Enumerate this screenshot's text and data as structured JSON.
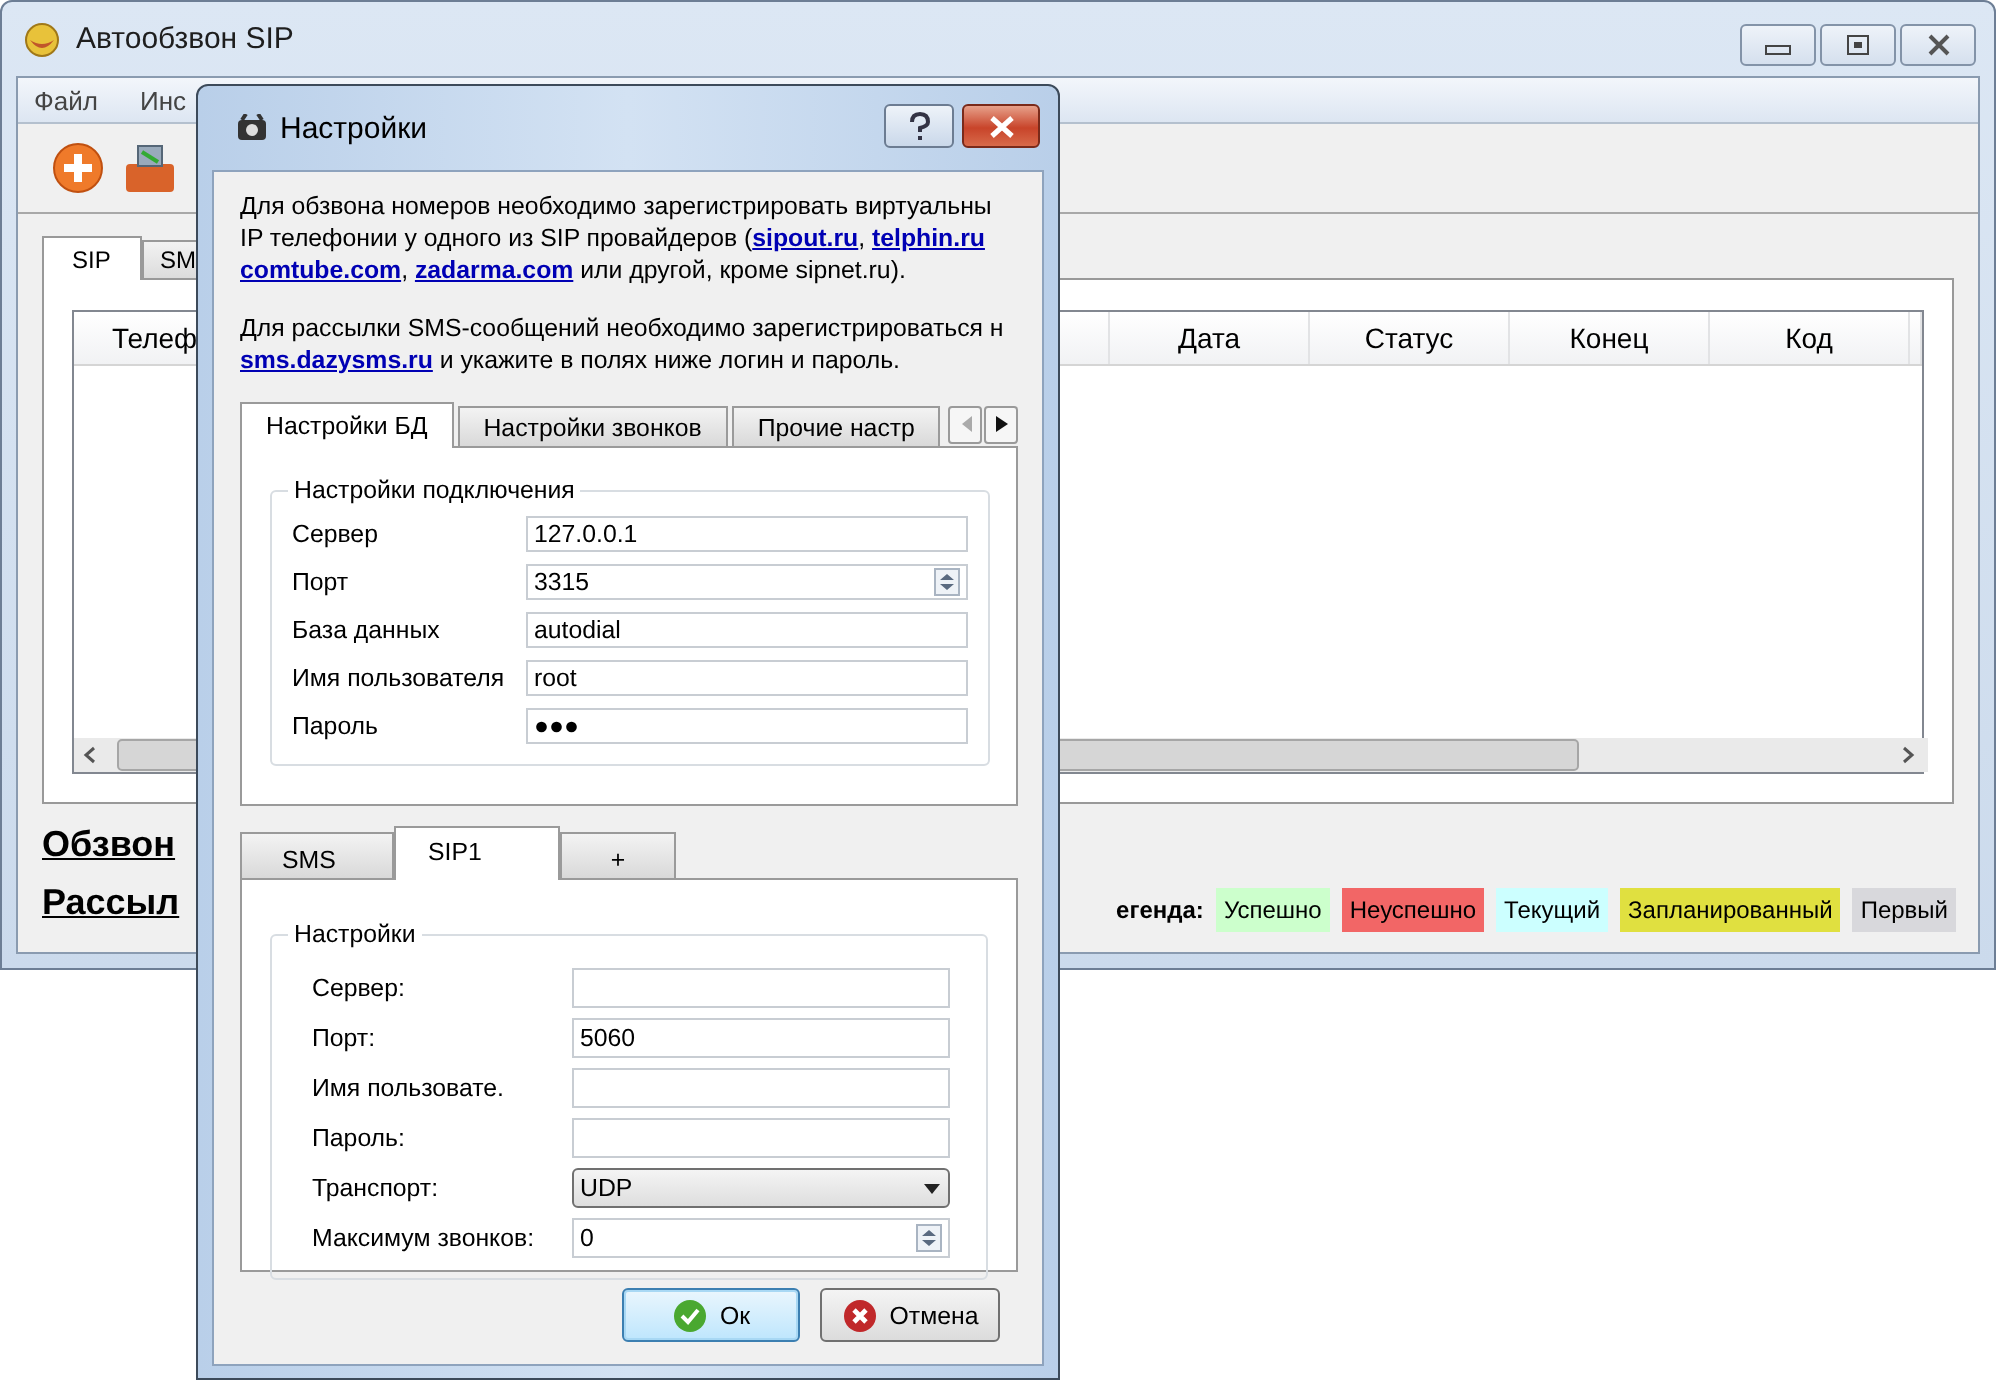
{
  "main_window": {
    "title": "Автообзвон SIP",
    "menu": [
      {
        "label": "Файл"
      },
      {
        "label": "Инс"
      }
    ],
    "tabs": [
      {
        "label": "SIP",
        "selected": true
      },
      {
        "label": "SM",
        "selected": false
      }
    ],
    "table": {
      "columns": [
        "Телеф",
        "Дата",
        "Статус",
        "Конец",
        "Код"
      ]
    },
    "links": [
      "Обзвон",
      "Рассыл"
    ],
    "legend": {
      "label": "егенда:",
      "items": [
        {
          "label": "Успешно",
          "color": "#ccffcc"
        },
        {
          "label": "Неуспешно",
          "color": "#f26666"
        },
        {
          "label": "Текущий",
          "color": "#ccffff"
        },
        {
          "label": "Запланированный",
          "color": "#e0e040"
        },
        {
          "label": "Первый",
          "color": "#d8d8dc"
        }
      ]
    }
  },
  "dialog": {
    "title": "Настройки",
    "paragraphs": [
      {
        "lines": [
          [
            {
              "text": "Для обзвона номеров необходимо зарегистрировать виртуальны",
              "kind": "text"
            }
          ],
          [
            {
              "text": "IP телефонии у одного из SIP провайдеров (",
              "kind": "text"
            },
            {
              "text": "sipout.ru",
              "kind": "link",
              "after": ", "
            },
            {
              "text": "telphin.ru",
              "kind": "link"
            }
          ],
          [
            {
              "text": "comtube.com",
              "kind": "link",
              "after": ", "
            },
            {
              "text": "zadarma.com",
              "kind": "link"
            },
            {
              "text": " или другой, кроме sipnet.ru).",
              "kind": "text"
            }
          ]
        ]
      },
      {
        "lines": [
          [
            {
              "text": "Для рассылки SMS-сообщений необходимо зарегистрироваться н",
              "kind": "text"
            }
          ],
          [
            {
              "text": "sms.dazysms.ru",
              "kind": "link"
            },
            {
              "text": " и укажите в полях ниже логин и пароль.",
              "kind": "text"
            }
          ]
        ]
      }
    ],
    "tabs": [
      {
        "label": "Настройки БД",
        "selected": true
      },
      {
        "label": "Настройки звонков",
        "selected": false
      },
      {
        "label": "Прочие настр",
        "selected": false
      }
    ],
    "connection_group": {
      "title": "Настройки подключения",
      "fields": [
        {
          "label": "Сервер",
          "value": "127.0.0.1",
          "kind": "text"
        },
        {
          "label": "Порт",
          "value": "3315",
          "kind": "spin"
        },
        {
          "label": "База данных",
          "value": "autodial",
          "kind": "text"
        },
        {
          "label": "Имя пользователя",
          "value": "root",
          "kind": "text"
        },
        {
          "label": "Пароль",
          "value": "●●●",
          "kind": "password"
        }
      ]
    },
    "account_tabs": [
      {
        "label": "SMS",
        "selected": false
      },
      {
        "label": "SIP1",
        "selected": true
      },
      {
        "label": "+",
        "selected": false
      }
    ],
    "sip_group": {
      "title": "Настройки",
      "fields": [
        {
          "label": "Сервер:",
          "kind": "text"
        },
        {
          "label": "Порт:",
          "value": "5060",
          "kind": "text"
        },
        {
          "label": "Имя пользовате.",
          "kind": "text"
        },
        {
          "label": "Пароль:",
          "kind": "text"
        },
        {
          "label": "Транспорт:",
          "value": "UDP",
          "kind": "select"
        },
        {
          "label": "Максимум звонков:",
          "value": "0",
          "kind": "spin"
        }
      ]
    },
    "buttons": [
      {
        "label": "Ок",
        "kind": "ok",
        "focused": true
      },
      {
        "label": "Отмена",
        "kind": "cancel",
        "focused": false
      }
    ]
  }
}
